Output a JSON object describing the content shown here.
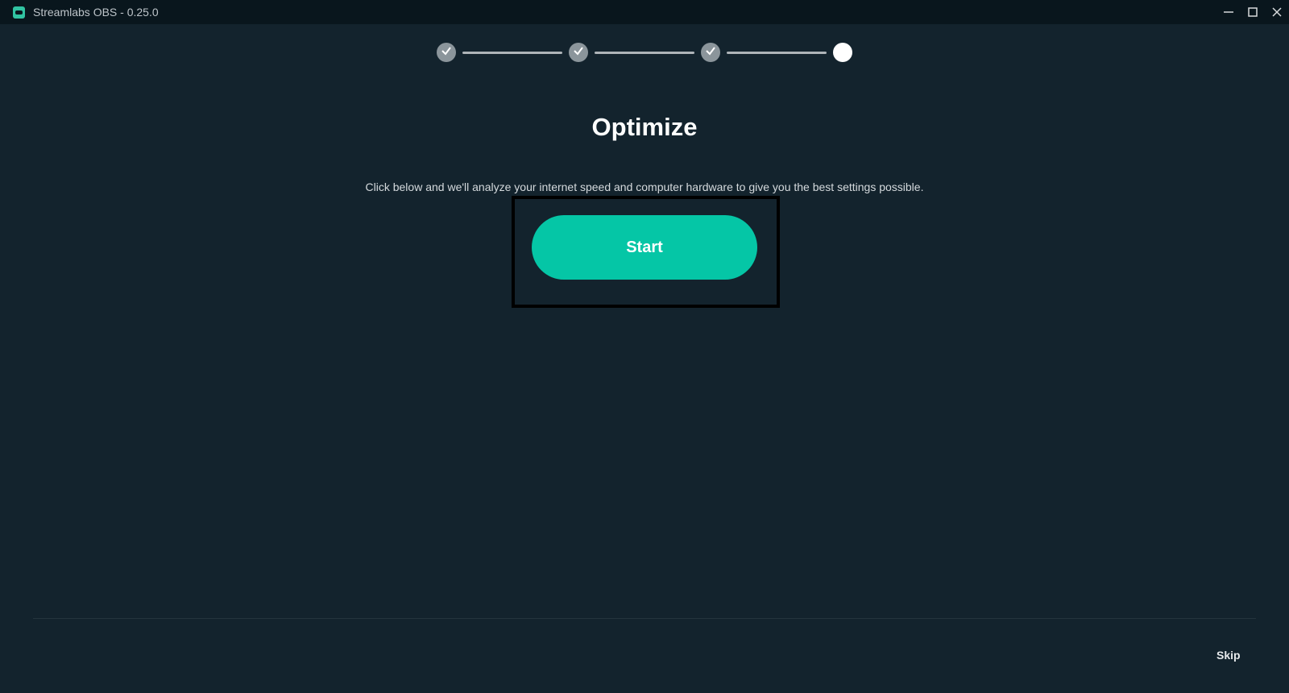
{
  "window": {
    "title": "Streamlabs OBS - 0.25.0",
    "controls": [
      "minimize-icon",
      "maximize-icon",
      "close-icon"
    ]
  },
  "stepper": {
    "steps": [
      {
        "state": "completed",
        "icon": "check-icon"
      },
      {
        "state": "completed",
        "icon": "check-icon"
      },
      {
        "state": "completed",
        "icon": "check-icon"
      },
      {
        "state": "current",
        "icon": ""
      }
    ]
  },
  "main": {
    "title": "Optimize",
    "description": "Click below and we'll analyze your internet speed and computer hardware to give you the best settings possible.",
    "start_label": "Start"
  },
  "footer": {
    "skip_label": "Skip"
  },
  "colors": {
    "background": "#13232d",
    "titlebar": "#09161d",
    "accent": "#05c6a6",
    "step_completed": "#8b959b",
    "step_current": "#ffffff"
  }
}
